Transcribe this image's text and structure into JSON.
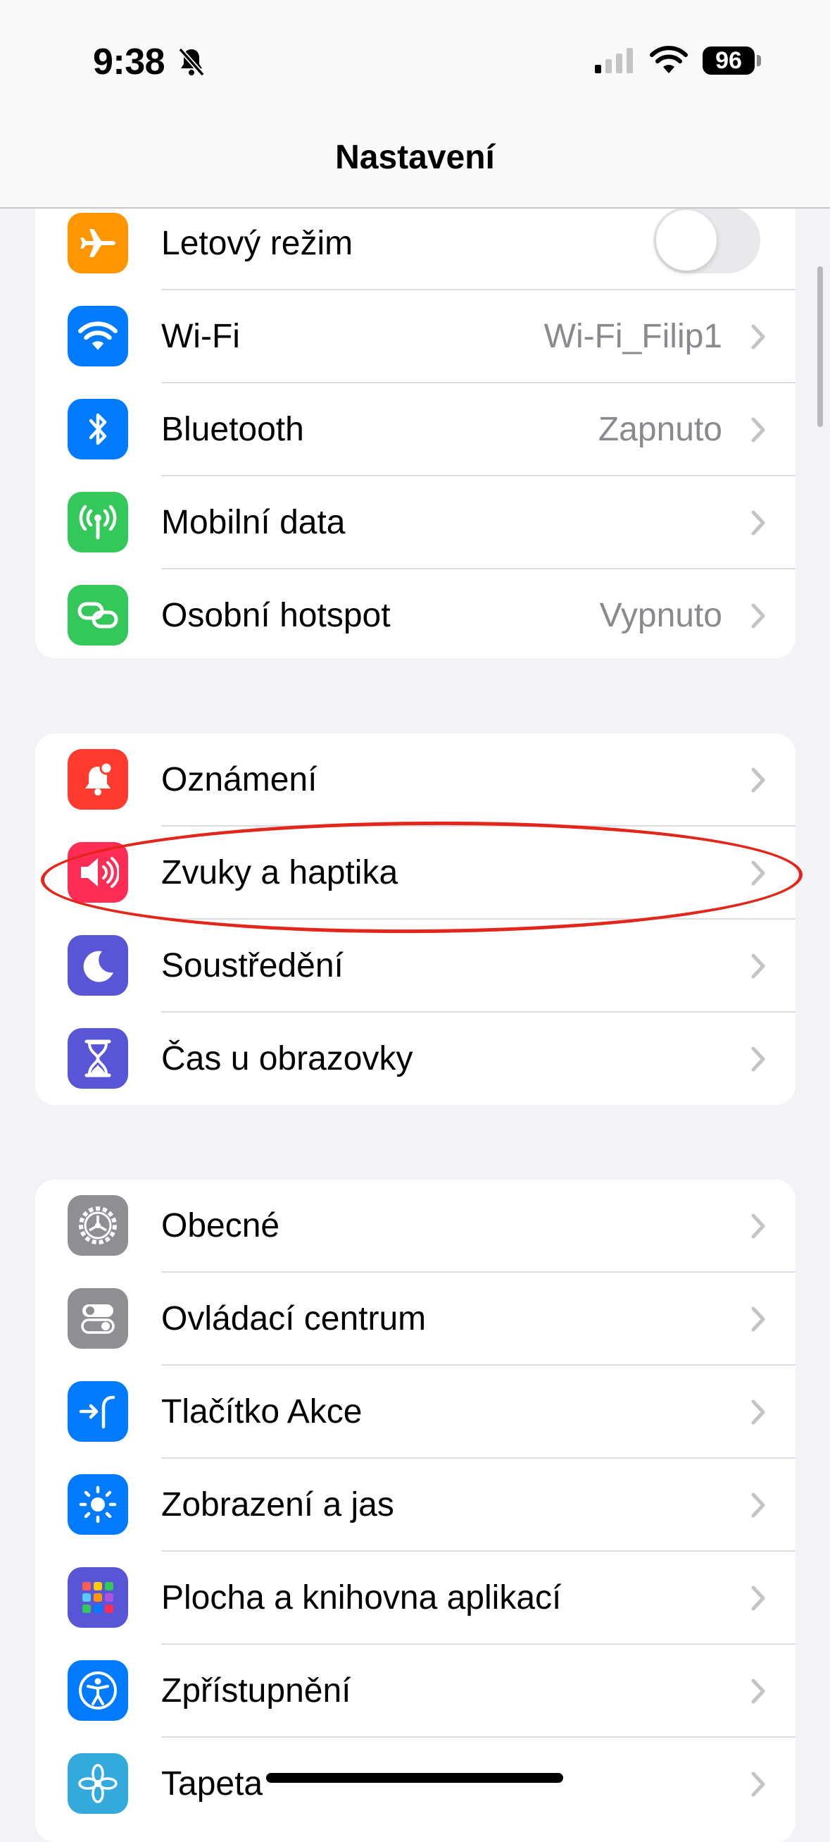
{
  "status_bar": {
    "time": "9:38",
    "battery": "96",
    "icons": [
      "bell-slash-icon",
      "cellular-signal-icon",
      "wifi-icon",
      "battery-icon"
    ]
  },
  "header": {
    "title": "Nastavení"
  },
  "groups": [
    {
      "items": [
        {
          "label": "Letový režim",
          "value": "",
          "icon": "airplane-icon",
          "color": "#ff9500",
          "control": "toggle",
          "toggle_on": false
        },
        {
          "label": "Wi-Fi",
          "value": "Wi-Fi_Filip1",
          "icon": "wifi-icon",
          "color": "#007aff"
        },
        {
          "label": "Bluetooth",
          "value": "Zapnuto",
          "icon": "bluetooth-icon",
          "color": "#007aff"
        },
        {
          "label": "Mobilní data",
          "value": "",
          "icon": "antenna-icon",
          "color": "#34c759"
        },
        {
          "label": "Osobní hotspot",
          "value": "Vypnuto",
          "icon": "hotspot-link-icon",
          "color": "#34c759"
        }
      ]
    },
    {
      "items": [
        {
          "label": "Oznámení",
          "value": "",
          "icon": "notification-bell-icon",
          "color": "#ff3b30"
        },
        {
          "label": "Zvuky a haptika",
          "value": "",
          "icon": "speaker-icon",
          "color": "#ff2d55",
          "highlighted": true
        },
        {
          "label": "Soustředění",
          "value": "",
          "icon": "moon-icon",
          "color": "#5856d6"
        },
        {
          "label": "Čas u obrazovky",
          "value": "",
          "icon": "hourglass-icon",
          "color": "#5856d6"
        }
      ]
    },
    {
      "items": [
        {
          "label": "Obecné",
          "value": "",
          "icon": "gear-icon",
          "color": "#8e8e93"
        },
        {
          "label": "Ovládací centrum",
          "value": "",
          "icon": "switches-icon",
          "color": "#8e8e93"
        },
        {
          "label": "Tlačítko Akce",
          "value": "",
          "icon": "action-button-icon",
          "color": "#007aff"
        },
        {
          "label": "Zobrazení a jas",
          "value": "",
          "icon": "sun-icon",
          "color": "#007aff"
        },
        {
          "label": "Plocha a knihovna aplikací",
          "value": "",
          "icon": "app-grid-icon",
          "color": "#5856d6"
        },
        {
          "label": "Zpřístupnění",
          "value": "",
          "icon": "accessibility-icon",
          "color": "#007aff"
        },
        {
          "label": "Tapeta",
          "value": "",
          "icon": "flower-icon",
          "color": "#34aadc"
        }
      ]
    }
  ]
}
